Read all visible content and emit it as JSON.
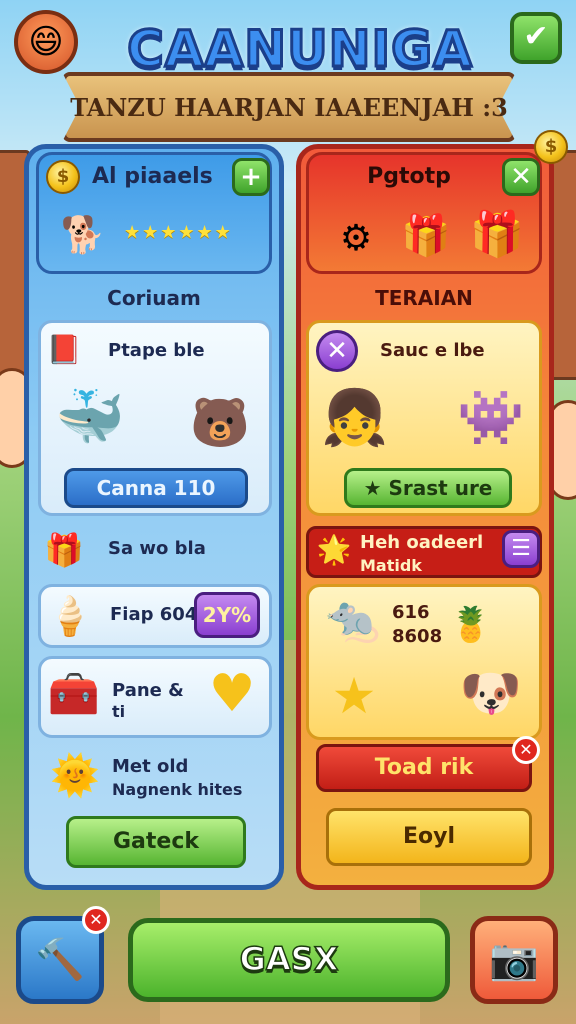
{
  "header": {
    "title": "CAANUNIGA",
    "subtitle": "TANZU HAARJAN IAAEENJAH :3",
    "avatar_icon": "😄",
    "check_icon": "✔"
  },
  "left_panel": {
    "title": "Al piaaels",
    "add_icon": "+",
    "stars": "★★★★★★",
    "section_label": "Coriuam",
    "row1_label": "Ptape ble",
    "button1_label": "Canna 110",
    "row2_label": "Sa wo bla",
    "row3_label": "Fiap 604",
    "row3_badge": "2Y%",
    "row4_label": "Pane &",
    "row4_sub": "ti",
    "row5_label": "Met old",
    "row5_sub": "Nagnenk hites",
    "bottom_button": "Gateck"
  },
  "right_panel": {
    "title": "Pgtotp",
    "close_icon": "✕",
    "section_label": "TERAIAN",
    "row1_label": "Sauc e lbe",
    "button1_label": "Srast ure",
    "row2_label": "Heh oadeerl",
    "row2_sub": "Matidk",
    "row3_value_a": "616",
    "row3_value_b": "8608",
    "red_button_label": "Toad rik",
    "bottom_button": "Eoyl"
  },
  "footer": {
    "main_button": "GASX"
  },
  "colors": {
    "left_panel_border": "#2a5fa8",
    "right_panel_border": "#a8261b",
    "main_button": "#4cb32c"
  }
}
